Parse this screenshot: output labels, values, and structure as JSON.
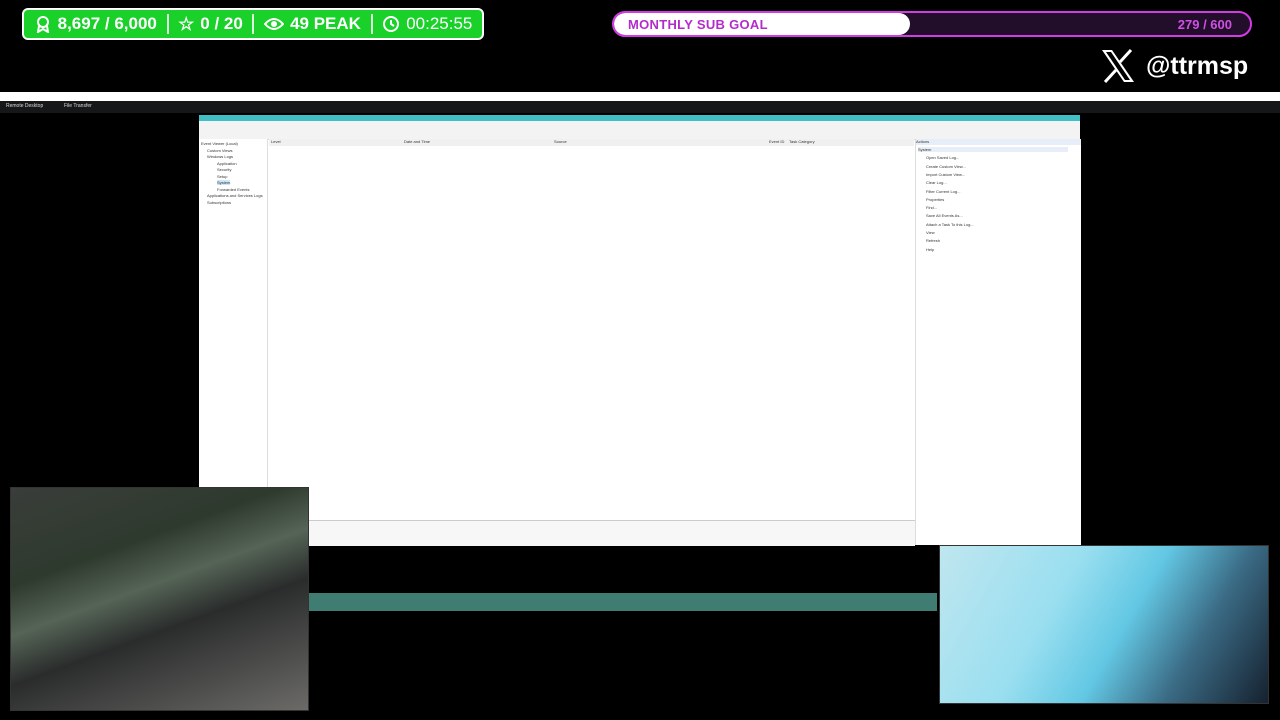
{
  "stats": {
    "followers": "8,697 / 6,000",
    "stars": "0 / 20",
    "peak": "49 PEAK",
    "timer": "00:25:55"
  },
  "sub_goal": {
    "label": "MONTHLY SUB GOAL",
    "count": "279 / 600",
    "progress": 0.465
  },
  "social": {
    "handle": "@ttrmsp"
  },
  "remote_desktop": {
    "tab": "Remote Desktop",
    "tab2": "File Transfer"
  },
  "event_viewer": {
    "tree": [
      "Event Viewer (Local)",
      "Custom Views",
      "Windows Logs",
      "Application",
      "Security",
      "Setup",
      "System",
      "Forwarded Events",
      "Applications and Services Logs",
      "Subscriptions"
    ],
    "list_header": [
      "Level",
      "Date and Time",
      "Source",
      "Event ID",
      "Task Category"
    ],
    "actions_header": "Actions",
    "actions": [
      "System",
      "Open Saved Log...",
      "Create Custom View...",
      "Import Custom View...",
      "Clear Log...",
      "Filter Current Log...",
      "Properties",
      "Find...",
      "Save All Events As...",
      "Attach a Task To this Log...",
      "View",
      "Refresh",
      "Help"
    ]
  },
  "colors": {
    "stats_bg": "#1ad12a",
    "goal_border": "#d43ae6",
    "goal_text": "#b42bcc",
    "ev_title": "#40bfc6",
    "taskbar": "#3f7c72"
  }
}
